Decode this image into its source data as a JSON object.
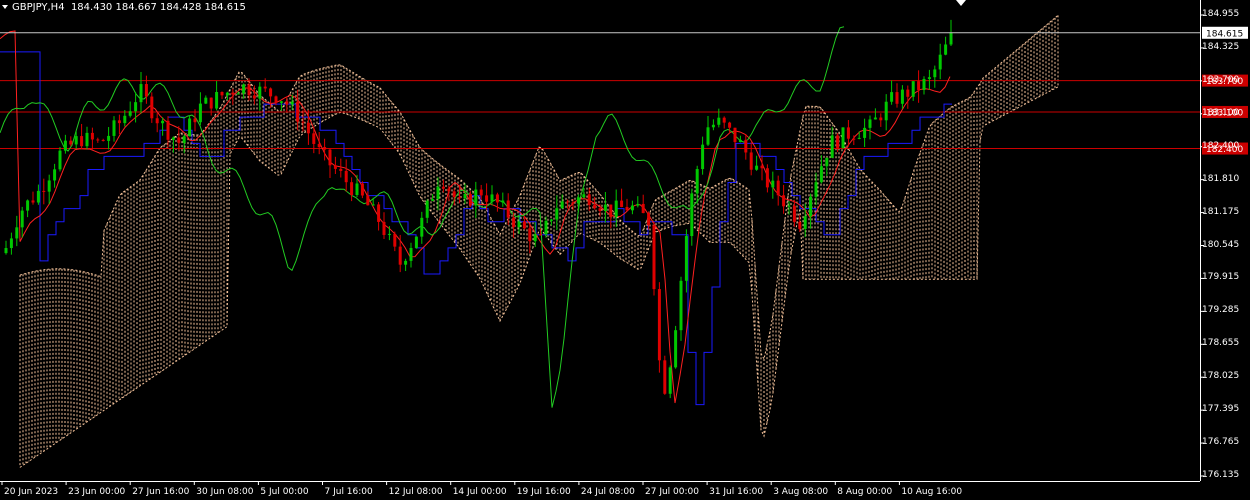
{
  "header": {
    "symbol": "GBPJPY,H4",
    "ohlc": "184.430 184.667 184.428 184.615"
  },
  "price_axis": {
    "ticks": [
      "184.955",
      "184.325",
      "183.700",
      "183.100",
      "182.400",
      "181.810",
      "181.175",
      "180.545",
      "179.915",
      "179.285",
      "178.655",
      "178.025",
      "177.395",
      "176.765",
      "176.135"
    ],
    "current_price": "184.615",
    "hlines": [
      {
        "label": "183.700",
        "color": "#cc0000"
      },
      {
        "label": "183.100",
        "color": "#cc0000"
      },
      {
        "label": "182.400",
        "color": "#cc0000"
      }
    ]
  },
  "time_axis": {
    "labels": [
      "20 Jun 2023",
      "23 Jun 00:00",
      "27 Jun 16:00",
      "30 Jun 08:00",
      "5 Jul 00:00",
      "7 Jul 16:00",
      "12 Jul 08:00",
      "14 Jul 00:00",
      "19 Jul 16:00",
      "24 Jul 08:00",
      "27 Jul 00:00",
      "31 Jul 16:00",
      "3 Aug 08:00",
      "8 Aug 00:00",
      "10 Aug 16:00"
    ]
  },
  "colors": {
    "background": "#000000",
    "bull_candle": "#00c800",
    "bear_candle": "#e00000",
    "tenkan": "#ff2020",
    "kijun": "#1a1aff",
    "chikou": "#22cc22",
    "cloud": "#f4c29a",
    "hline": "#cc0000",
    "axis_text": "#ffffff"
  },
  "chart_data": {
    "type": "candlestick",
    "indicator": "Ichimoku",
    "ylim": [
      176.135,
      184.955
    ]
  }
}
